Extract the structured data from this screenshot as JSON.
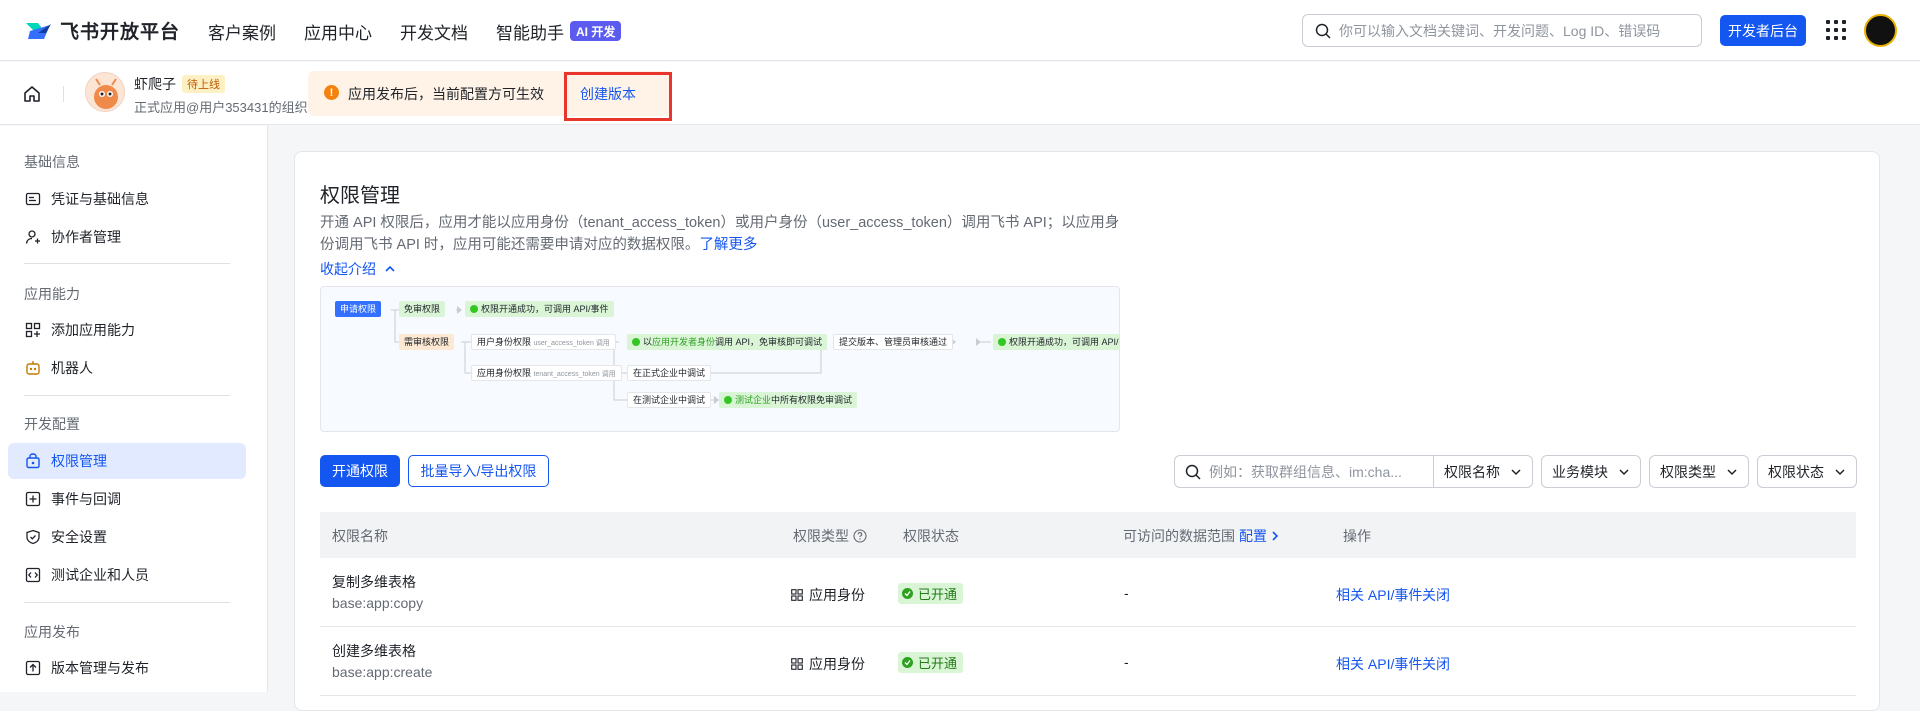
{
  "topbar": {
    "logo_text": "飞书开放平台",
    "nav": [
      "客户案例",
      "应用中心",
      "开发文档",
      "智能助手"
    ],
    "ai_badge": "AI 开发",
    "search_placeholder": "你可以输入文档关键词、开发问题、Log ID、错误码",
    "dev_console_button": "开发者后台"
  },
  "subbar": {
    "app_name": "虾爬子",
    "app_status": "待上线",
    "app_org": "正式应用@用户353431的组织",
    "notice_text": "应用发布后，当前配置方可生效",
    "notice_link": "创建版本"
  },
  "sidebar": {
    "groups": [
      {
        "title": "基础信息",
        "items": [
          "凭证与基础信息",
          "协作者管理"
        ]
      },
      {
        "title": "应用能力",
        "items": [
          "添加应用能力",
          "机器人"
        ]
      },
      {
        "title": "开发配置",
        "items": [
          "权限管理",
          "事件与回调",
          "安全设置",
          "测试企业和人员"
        ]
      },
      {
        "title": "应用发布",
        "items": [
          "版本管理与发布"
        ]
      }
    ],
    "active": "权限管理"
  },
  "main": {
    "title": "权限管理",
    "desc_1": "开通 API 权限后，应用才能以应用身份（tenant_access_token）或用户身份（user_access_token）调用飞书 API；以应用身份调用飞书 API 时，应用可能还需要申请对应的数据权限。",
    "desc_link": "了解更多",
    "collapse": "收起介绍",
    "flow": {
      "apply": "申请权限",
      "free": "免审权限",
      "free_result": "权限开通成功，可调用 API/事件",
      "review": "需审核权限",
      "user_identity": "用户身份权限",
      "user_token": "user_access_token 调用",
      "dev_identity_a": "以",
      "dev_identity_b": "应用开发者身份",
      "dev_identity_c": "调用 API，免审核即可调试",
      "submit": "提交版本、管理员审核通过",
      "final_result": "权限开通成功，可调用 API/事件",
      "app_identity": "应用身份权限",
      "tenant_token": "tenant_access_token 调用",
      "formal_debug": "在正式企业中调试",
      "test_debug": "在测试企业中调试",
      "test_result_a": "测试企业",
      "test_result_b": "中所有权限免审调试"
    },
    "open_button": "开通权限",
    "bulk_button": "批量导入/导出权限",
    "filter_placeholder": "例如：获取群组信息、im:cha...",
    "filter_name": "权限名称",
    "filter_module": "业务模块",
    "filter_type": "权限类型",
    "filter_status": "权限状态"
  },
  "table": {
    "headers": {
      "name": "权限名称",
      "type": "权限类型",
      "status": "权限状态",
      "range": "可访问的数据范围",
      "range_link": "配置",
      "action": "操作"
    },
    "rows": [
      {
        "name": "复制多维表格",
        "code": "base:app:copy",
        "type": "应用身份",
        "status": "已开通",
        "range": "-",
        "action1": "相关 API/事件",
        "action2": "关闭"
      },
      {
        "name": "创建多维表格",
        "code": "base:app:create",
        "type": "应用身份",
        "status": "已开通",
        "range": "-",
        "action1": "相关 API/事件",
        "action2": "关闭"
      }
    ]
  },
  "colors": {
    "accent": "#1456f0",
    "active_bg": "#e1eaff",
    "success": "#2ea121",
    "warning": "#f5820c",
    "highlight_box": "#e8362c"
  }
}
